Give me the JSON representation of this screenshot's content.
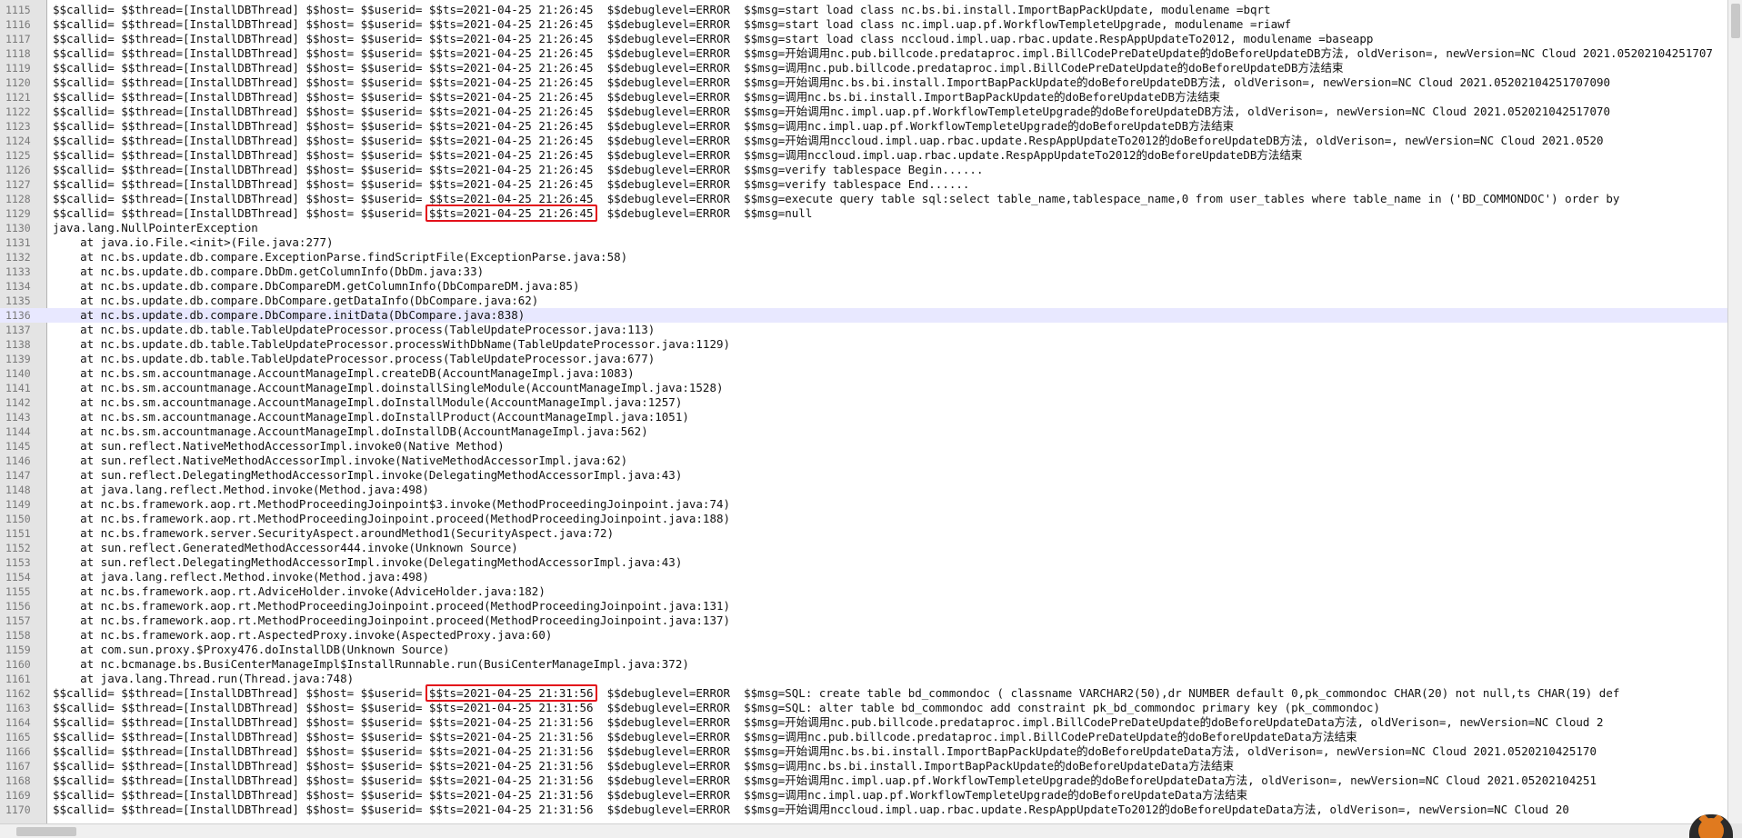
{
  "log": {
    "current_line": 1136,
    "lines": [
      {
        "n": "1115",
        "text": "$$callid= $$thread=[InstallDBThread] $$host= $$userid= $$ts=2021-04-25 21:26:45  $$debuglevel=ERROR  $$msg=start load class nc.bs.bi.install.ImportBapPackUpdate, modulename =bqrt"
      },
      {
        "n": "1116",
        "text": "$$callid= $$thread=[InstallDBThread] $$host= $$userid= $$ts=2021-04-25 21:26:45  $$debuglevel=ERROR  $$msg=start load class nc.impl.uap.pf.WorkflowTempleteUpgrade, modulename =riawf"
      },
      {
        "n": "1117",
        "text": "$$callid= $$thread=[InstallDBThread] $$host= $$userid= $$ts=2021-04-25 21:26:45  $$debuglevel=ERROR  $$msg=start load class nccloud.impl.uap.rbac.update.RespAppUpdateTo2012, modulename =baseapp"
      },
      {
        "n": "1118",
        "text": "$$callid= $$thread=[InstallDBThread] $$host= $$userid= $$ts=2021-04-25 21:26:45  $$debuglevel=ERROR  $$msg=开始调用nc.pub.billcode.predataproc.impl.BillCodePreDateUpdate的doBeforeUpdateDB方法, oldVerison=, newVersion=NC Cloud 2021.05202104251707"
      },
      {
        "n": "1119",
        "text": "$$callid= $$thread=[InstallDBThread] $$host= $$userid= $$ts=2021-04-25 21:26:45  $$debuglevel=ERROR  $$msg=调用nc.pub.billcode.predataproc.impl.BillCodePreDateUpdate的doBeforeUpdateDB方法结束"
      },
      {
        "n": "1120",
        "text": "$$callid= $$thread=[InstallDBThread] $$host= $$userid= $$ts=2021-04-25 21:26:45  $$debuglevel=ERROR  $$msg=开始调用nc.bs.bi.install.ImportBapPackUpdate的doBeforeUpdateDB方法, oldVerison=, newVersion=NC Cloud 2021.05202104251707090"
      },
      {
        "n": "1121",
        "text": "$$callid= $$thread=[InstallDBThread] $$host= $$userid= $$ts=2021-04-25 21:26:45  $$debuglevel=ERROR  $$msg=调用nc.bs.bi.install.ImportBapPackUpdate的doBeforeUpdateDB方法结束"
      },
      {
        "n": "1122",
        "text": "$$callid= $$thread=[InstallDBThread] $$host= $$userid= $$ts=2021-04-25 21:26:45  $$debuglevel=ERROR  $$msg=开始调用nc.impl.uap.pf.WorkflowTempleteUpgrade的doBeforeUpdateDB方法, oldVerison=, newVersion=NC Cloud 2021.052021042517070"
      },
      {
        "n": "1123",
        "text": "$$callid= $$thread=[InstallDBThread] $$host= $$userid= $$ts=2021-04-25 21:26:45  $$debuglevel=ERROR  $$msg=调用nc.impl.uap.pf.WorkflowTempleteUpgrade的doBeforeUpdateDB方法结束"
      },
      {
        "n": "1124",
        "text": "$$callid= $$thread=[InstallDBThread] $$host= $$userid= $$ts=2021-04-25 21:26:45  $$debuglevel=ERROR  $$msg=开始调用nccloud.impl.uap.rbac.update.RespAppUpdateTo2012的doBeforeUpdateDB方法, oldVerison=, newVersion=NC Cloud 2021.0520"
      },
      {
        "n": "1125",
        "text": "$$callid= $$thread=[InstallDBThread] $$host= $$userid= $$ts=2021-04-25 21:26:45  $$debuglevel=ERROR  $$msg=调用nccloud.impl.uap.rbac.update.RespAppUpdateTo2012的doBeforeUpdateDB方法结束"
      },
      {
        "n": "1126",
        "text": "$$callid= $$thread=[InstallDBThread] $$host= $$userid= $$ts=2021-04-25 21:26:45  $$debuglevel=ERROR  $$msg=verify tablespace Begin......"
      },
      {
        "n": "1127",
        "text": "$$callid= $$thread=[InstallDBThread] $$host= $$userid= $$ts=2021-04-25 21:26:45  $$debuglevel=ERROR  $$msg=verify tablespace End......"
      },
      {
        "n": "1128",
        "text": "$$callid= $$thread=[InstallDBThread] $$host= $$userid= $$ts=2021-04-25 21:26:45  $$debuglevel=ERROR  $$msg=execute query table sql:select table_name,tablespace_name,0 from user_tables where table_name in ('BD_COMMONDOC') order by"
      },
      {
        "n": "1129",
        "text": "$$callid= $$thread=[InstallDBThread] $$host= $$userid= $$ts=2021-04-25 21:26:45  $$debuglevel=ERROR  $$msg=null"
      },
      {
        "n": "1130",
        "text": "java.lang.NullPointerException"
      },
      {
        "n": "1131",
        "text": "    at java.io.File.<init>(File.java:277)"
      },
      {
        "n": "1132",
        "text": "    at nc.bs.update.db.compare.ExceptionParse.findScriptFile(ExceptionParse.java:58)"
      },
      {
        "n": "1133",
        "text": "    at nc.bs.update.db.compare.DbDm.getColumnInfo(DbDm.java:33)"
      },
      {
        "n": "1134",
        "text": "    at nc.bs.update.db.compare.DbCompareDM.getColumnInfo(DbCompareDM.java:85)"
      },
      {
        "n": "1135",
        "text": "    at nc.bs.update.db.compare.DbCompare.getDataInfo(DbCompare.java:62)"
      },
      {
        "n": "1136",
        "text": "    at nc.bs.update.db.compare.DbCompare.initData(DbCompare.java:838)"
      },
      {
        "n": "1137",
        "text": "    at nc.bs.update.db.table.TableUpdateProcessor.process(TableUpdateProcessor.java:113)"
      },
      {
        "n": "1138",
        "text": "    at nc.bs.update.db.table.TableUpdateProcessor.processWithDbName(TableUpdateProcessor.java:1129)"
      },
      {
        "n": "1139",
        "text": "    at nc.bs.update.db.table.TableUpdateProcessor.process(TableUpdateProcessor.java:677)"
      },
      {
        "n": "1140",
        "text": "    at nc.bs.sm.accountmanage.AccountManageImpl.createDB(AccountManageImpl.java:1083)"
      },
      {
        "n": "1141",
        "text": "    at nc.bs.sm.accountmanage.AccountManageImpl.doinstallSingleModule(AccountManageImpl.java:1528)"
      },
      {
        "n": "1142",
        "text": "    at nc.bs.sm.accountmanage.AccountManageImpl.doInstallModule(AccountManageImpl.java:1257)"
      },
      {
        "n": "1143",
        "text": "    at nc.bs.sm.accountmanage.AccountManageImpl.doInstallProduct(AccountManageImpl.java:1051)"
      },
      {
        "n": "1144",
        "text": "    at nc.bs.sm.accountmanage.AccountManageImpl.doInstallDB(AccountManageImpl.java:562)"
      },
      {
        "n": "1145",
        "text": "    at sun.reflect.NativeMethodAccessorImpl.invoke0(Native Method)"
      },
      {
        "n": "1146",
        "text": "    at sun.reflect.NativeMethodAccessorImpl.invoke(NativeMethodAccessorImpl.java:62)"
      },
      {
        "n": "1147",
        "text": "    at sun.reflect.DelegatingMethodAccessorImpl.invoke(DelegatingMethodAccessorImpl.java:43)"
      },
      {
        "n": "1148",
        "text": "    at java.lang.reflect.Method.invoke(Method.java:498)"
      },
      {
        "n": "1149",
        "text": "    at nc.bs.framework.aop.rt.MethodProceedingJoinpoint$3.invoke(MethodProceedingJoinpoint.java:74)"
      },
      {
        "n": "1150",
        "text": "    at nc.bs.framework.aop.rt.MethodProceedingJoinpoint.proceed(MethodProceedingJoinpoint.java:188)"
      },
      {
        "n": "1151",
        "text": "    at nc.bs.framework.server.SecurityAspect.aroundMethod1(SecurityAspect.java:72)"
      },
      {
        "n": "1152",
        "text": "    at sun.reflect.GeneratedMethodAccessor444.invoke(Unknown Source)"
      },
      {
        "n": "1153",
        "text": "    at sun.reflect.DelegatingMethodAccessorImpl.invoke(DelegatingMethodAccessorImpl.java:43)"
      },
      {
        "n": "1154",
        "text": "    at java.lang.reflect.Method.invoke(Method.java:498)"
      },
      {
        "n": "1155",
        "text": "    at nc.bs.framework.aop.rt.AdviceHolder.invoke(AdviceHolder.java:182)"
      },
      {
        "n": "1156",
        "text": "    at nc.bs.framework.aop.rt.MethodProceedingJoinpoint.proceed(MethodProceedingJoinpoint.java:131)"
      },
      {
        "n": "1157",
        "text": "    at nc.bs.framework.aop.rt.MethodProceedingJoinpoint.proceed(MethodProceedingJoinpoint.java:137)"
      },
      {
        "n": "1158",
        "text": "    at nc.bs.framework.aop.rt.AspectedProxy.invoke(AspectedProxy.java:60)"
      },
      {
        "n": "1159",
        "text": "    at com.sun.proxy.$Proxy476.doInstallDB(Unknown Source)"
      },
      {
        "n": "1160",
        "text": "    at nc.bcmanage.bs.BusiCenterManageImpl$InstallRunnable.run(BusiCenterManageImpl.java:372)"
      },
      {
        "n": "1161",
        "text": "    at java.lang.Thread.run(Thread.java:748)"
      },
      {
        "n": "1162",
        "text": "$$callid= $$thread=[InstallDBThread] $$host= $$userid= $$ts=2021-04-25 21:31:56  $$debuglevel=ERROR  $$msg=SQL: create table bd_commondoc ( classname VARCHAR2(50),dr NUMBER default 0,pk_commondoc CHAR(20) not null,ts CHAR(19) def"
      },
      {
        "n": "1163",
        "text": "$$callid= $$thread=[InstallDBThread] $$host= $$userid= $$ts=2021-04-25 21:31:56  $$debuglevel=ERROR  $$msg=SQL: alter table bd_commondoc add constraint pk_bd_commondoc primary key (pk_commondoc)"
      },
      {
        "n": "1164",
        "text": "$$callid= $$thread=[InstallDBThread] $$host= $$userid= $$ts=2021-04-25 21:31:56  $$debuglevel=ERROR  $$msg=开始调用nc.pub.billcode.predataproc.impl.BillCodePreDateUpdate的doBeforeUpdateData方法, oldVerison=, newVersion=NC Cloud 2"
      },
      {
        "n": "1165",
        "text": "$$callid= $$thread=[InstallDBThread] $$host= $$userid= $$ts=2021-04-25 21:31:56  $$debuglevel=ERROR  $$msg=调用nc.pub.billcode.predataproc.impl.BillCodePreDateUpdate的doBeforeUpdateData方法结束"
      },
      {
        "n": "1166",
        "text": "$$callid= $$thread=[InstallDBThread] $$host= $$userid= $$ts=2021-04-25 21:31:56  $$debuglevel=ERROR  $$msg=开始调用nc.bs.bi.install.ImportBapPackUpdate的doBeforeUpdateData方法, oldVerison=, newVersion=NC Cloud 2021.0520210425170"
      },
      {
        "n": "1167",
        "text": "$$callid= $$thread=[InstallDBThread] $$host= $$userid= $$ts=2021-04-25 21:31:56  $$debuglevel=ERROR  $$msg=调用nc.bs.bi.install.ImportBapPackUpdate的doBeforeUpdateData方法结束"
      },
      {
        "n": "1168",
        "text": "$$callid= $$thread=[InstallDBThread] $$host= $$userid= $$ts=2021-04-25 21:31:56  $$debuglevel=ERROR  $$msg=开始调用nc.impl.uap.pf.WorkflowTempleteUpgrade的doBeforeUpdateData方法, oldVerison=, newVersion=NC Cloud 2021.05202104251"
      },
      {
        "n": "1169",
        "text": "$$callid= $$thread=[InstallDBThread] $$host= $$userid= $$ts=2021-04-25 21:31:56  $$debuglevel=ERROR  $$msg=调用nc.impl.uap.pf.WorkflowTempleteUpgrade的doBeforeUpdateData方法结束"
      },
      {
        "n": "1170",
        "text": "$$callid= $$thread=[InstallDBThread] $$host= $$userid= $$ts=2021-04-25 21:31:56  $$debuglevel=ERROR  $$msg=开始调用nccloud.impl.uap.rbac.update.RespAppUpdateTo2012的doBeforeUpdateData方法, oldVerison=, newVersion=NC Cloud 20"
      }
    ]
  },
  "annotations": [
    {
      "line": 1129,
      "label": "$$ts=2021-04-25 21:26:45"
    },
    {
      "line": 1162,
      "label": "$$ts=2021-04-25 21:31:56"
    }
  ],
  "colors": {
    "highlight_box": "#e3101a",
    "current_line_bg": "#e8e8ff",
    "gutter_bg": "#e4e4e4"
  },
  "icons": {
    "tray": "cat-mascot-icon"
  }
}
